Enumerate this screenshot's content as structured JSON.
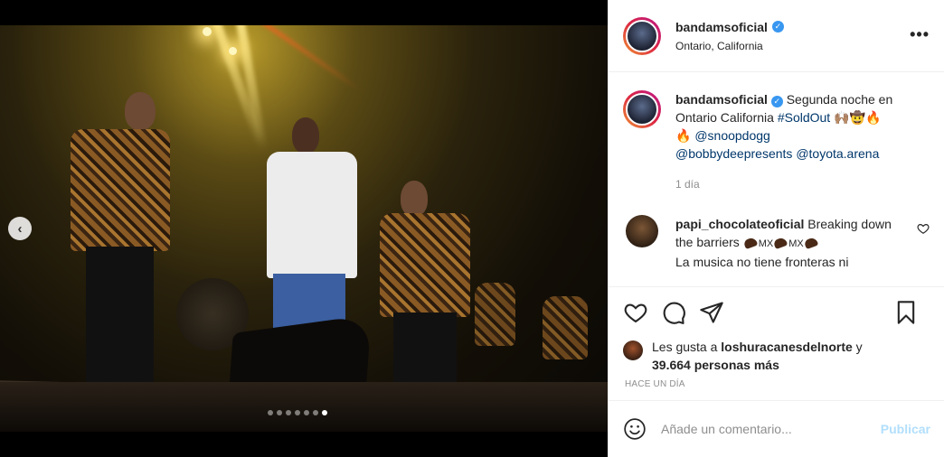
{
  "post": {
    "username": "bandamsoficial",
    "location": "Ontario, California",
    "more_label": "•••"
  },
  "caption": {
    "username": "bandamsoficial",
    "text_before": "Segunda noche en Ontario California ",
    "hashtag": "#SoldOut",
    "emoji_line": " 🙌🏽🤠🔥",
    "emoji_fire": "🔥 ",
    "mention1": "@snoopdogg",
    "mention2": "@bobbydeepresents",
    "mention3": "@toyota.arena",
    "time": "1 día"
  },
  "comment": {
    "username": "papi_chocolateoficial",
    "line1": "Breaking down the barriers ",
    "mx": "MX",
    "line2": "La musica no tiene fronteras ni"
  },
  "likes": {
    "prefix": "Les gusta a ",
    "user": "loshuracanesdelnorte",
    "suffix": " y",
    "count": "39.664 personas más"
  },
  "timestamp": "HACE UN DÍA",
  "add_comment": {
    "placeholder": "Añade un comentario...",
    "publish": "Publicar"
  },
  "carousel": {
    "total": 7,
    "active": 7
  },
  "colors": {
    "link": "#00376b",
    "verified": "#3897f0",
    "publish_disabled": "#b2dffc",
    "meta_gray": "#8e8e8e"
  }
}
